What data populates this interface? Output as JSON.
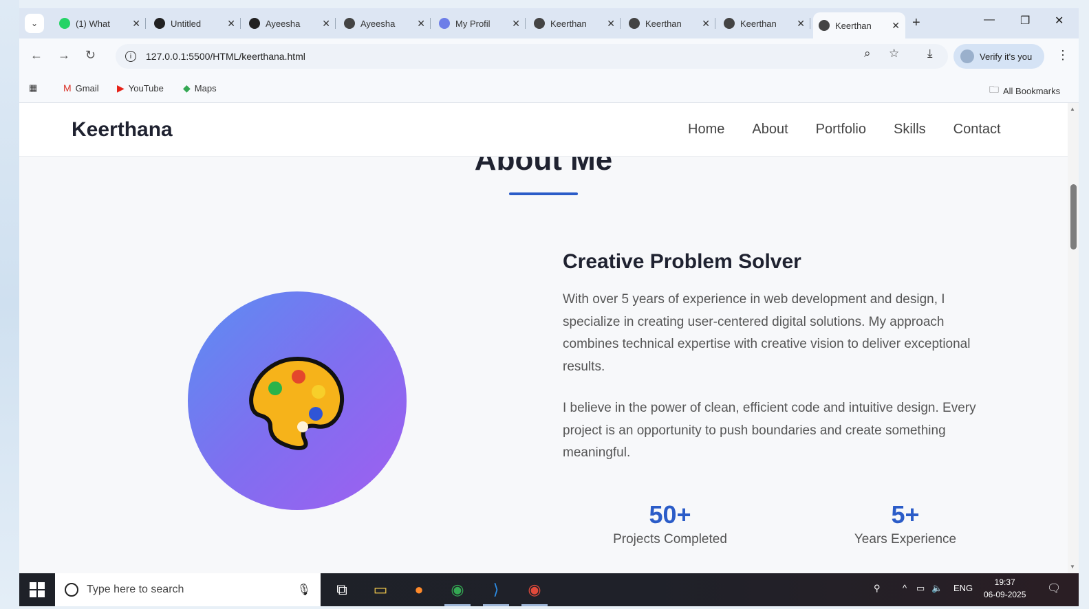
{
  "browser": {
    "tabs": [
      {
        "label": "(1) What",
        "icon": "whatsapp-icon",
        "color": "#25d366"
      },
      {
        "label": "Untitled",
        "icon": "codepen-icon",
        "color": "#222222"
      },
      {
        "label": "Ayeesha",
        "icon": "github-icon",
        "color": "#222222"
      },
      {
        "label": "Ayeesha",
        "icon": "globe-icon",
        "color": "#444444"
      },
      {
        "label": "My Profil",
        "icon": "stack-icon",
        "color": "#6d7ee8"
      },
      {
        "label": "Keerthan",
        "icon": "globe-icon",
        "color": "#444444"
      },
      {
        "label": "Keerthan",
        "icon": "globe-icon",
        "color": "#444444"
      },
      {
        "label": "Keerthan",
        "icon": "globe-icon",
        "color": "#444444"
      },
      {
        "label": "Keerthan",
        "icon": "globe-icon",
        "color": "#444444",
        "active": true
      }
    ],
    "url": "127.0.0.1:5500/HTML/keerthana.html",
    "verify_label": "Verify it's you",
    "bookmarks": [
      {
        "label": "Gmail",
        "icon": "gmail-icon"
      },
      {
        "label": "YouTube",
        "icon": "youtube-icon"
      },
      {
        "label": "Maps",
        "icon": "maps-icon"
      }
    ],
    "all_bookmarks": "All Bookmarks"
  },
  "site": {
    "brand": "Keerthana",
    "nav": [
      "Home",
      "About",
      "Portfolio",
      "Skills",
      "Contact"
    ],
    "section_title": "About Me",
    "avatar_icon": "palette-icon",
    "heading": "Creative Problem Solver",
    "paragraphs": [
      "With over 5 years of experience in web development and design, I specialize in creating user-centered digital solutions. My approach combines technical expertise with creative vision to deliver exceptional results.",
      "I believe in the power of clean, efficient code and intuitive design. Every project is an opportunity to push boundaries and create something meaningful."
    ],
    "stats": [
      {
        "number": "50+",
        "label": "Projects Completed"
      },
      {
        "number": "5+",
        "label": "Years Experience"
      }
    ],
    "accent_color": "#2b5cc8"
  },
  "taskbar": {
    "search_placeholder": "Type here to search",
    "language": "ENG",
    "time": "19:37",
    "date": "06-09-2025"
  }
}
